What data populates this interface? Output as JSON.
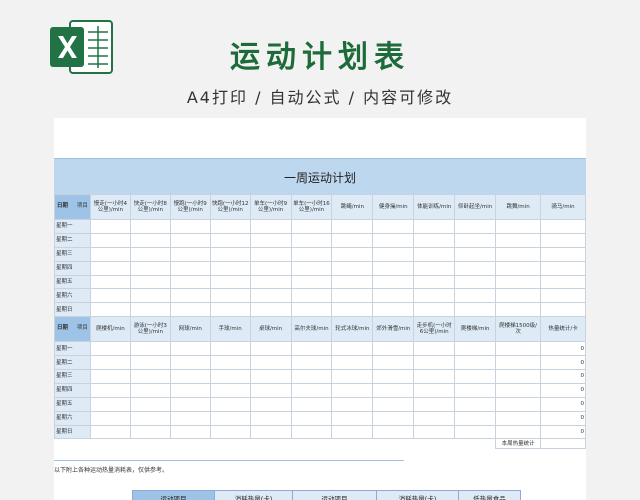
{
  "header": {
    "title": "运动计划表",
    "subtitle": "A4打印 / 自动公式 / 内容可修改"
  },
  "colors": {
    "brand_green": "#1d6b3a",
    "excel_green": "#217346",
    "header_blue": "#bdd7ee"
  },
  "sheet": {
    "title": "一周运动计划",
    "corner_left": "日期",
    "corner_right": "项目",
    "days": [
      "星期一",
      "星期二",
      "星期三",
      "星期四",
      "星期五",
      "星期六",
      "星期日"
    ],
    "section1_columns": [
      "慢走(一小时4公里)/min",
      "快走(一小时8公里)/min",
      "慢跑(一小时9公里)/min",
      "快跑(一小时12公里)/min",
      "单车(一小时9公里)/min",
      "单车(一小时16公里)/min",
      "跳绳/min",
      "健身操/min",
      "体能训练/min",
      "仰卧起坐/min",
      "跳舞/min",
      "骑马/min"
    ],
    "section2_columns": [
      "爬楼机/min",
      "游泳(一小时3公里)/min",
      "网球/min",
      "手球/min",
      "桌球/min",
      "高尔夫球/min",
      "轮式冰球/min",
      "郊外滑雪/min",
      "走步机(一小时6公里)/min",
      "爬楼梯/min",
      "爬楼梯1500级/次",
      "热量统计/卡"
    ],
    "row_total": "0",
    "weekly_total_label": "本周热量统计",
    "note": "以下附上各种运动热量消耗表，仅供参考。",
    "bottom_headers": [
      "运动项目",
      "消耗热量(卡)",
      "运动项目",
      "消耗热量(卡)",
      "低热量食品"
    ]
  }
}
